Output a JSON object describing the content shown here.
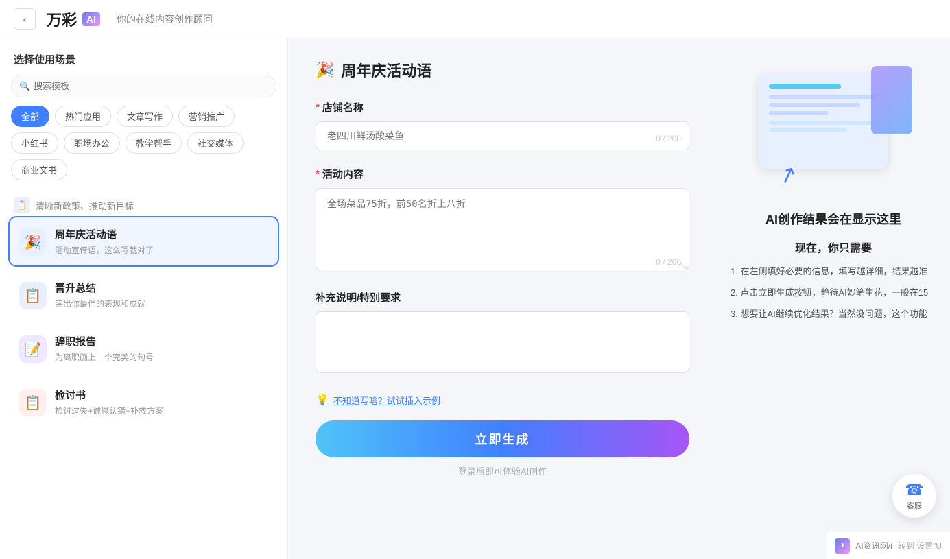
{
  "header": {
    "back_label": "‹",
    "logo_text": "万彩",
    "logo_ai": "AI",
    "subtitle": "你的在线内容创作顾问"
  },
  "sidebar": {
    "title": "选择使用场景",
    "search_placeholder": "搜索模板",
    "tags": [
      {
        "id": "all",
        "label": "全部",
        "active": true
      },
      {
        "id": "hot",
        "label": "热门应用",
        "active": false
      },
      {
        "id": "article",
        "label": "文章写作",
        "active": false
      },
      {
        "id": "marketing",
        "label": "营销推广",
        "active": false
      },
      {
        "id": "xiaohongshu",
        "label": "小红书",
        "active": false
      },
      {
        "id": "office",
        "label": "职场办公",
        "active": false
      },
      {
        "id": "education",
        "label": "教学帮手",
        "active": false
      },
      {
        "id": "social",
        "label": "社交媒体",
        "active": false
      },
      {
        "id": "business",
        "label": "商业文书",
        "active": false
      }
    ],
    "divider_text": "清晰新政策、推动新目标",
    "templates": [
      {
        "id": "anniversary",
        "icon": "🎉",
        "icon_style": "blue",
        "name": "周年庆活动语",
        "desc": "活动宣传语，这么写就对了",
        "active": true
      },
      {
        "id": "promotion",
        "icon": "📋",
        "icon_style": "blue",
        "name": "晋升总结",
        "desc": "突出你最佳的表现和成就",
        "active": false
      },
      {
        "id": "resignation",
        "icon": "📝",
        "icon_style": "purple",
        "name": "辞职报告",
        "desc": "为离职画上一个完美的句号",
        "active": false
      },
      {
        "id": "review",
        "icon": "📋",
        "icon_style": "red",
        "name": "检讨书",
        "desc": "检讨过失+诚恩认错+补救方案",
        "active": false
      }
    ]
  },
  "form": {
    "title": "周年庆活动语",
    "title_icon": "🎉",
    "fields": [
      {
        "id": "shop_name",
        "label": "店铺名称",
        "required": true,
        "type": "input",
        "placeholder": "老四川鲜汤酸菜鱼",
        "char_count": "0 / 200"
      },
      {
        "id": "activity_content",
        "label": "活动内容",
        "required": true,
        "type": "textarea",
        "placeholder": "全场菜品75折，前50名折上八折",
        "char_count": "0 / 200"
      },
      {
        "id": "supplement",
        "label": "补充说明/特别要求",
        "required": false,
        "type": "textarea",
        "placeholder": "",
        "char_count": ""
      }
    ],
    "hint_icon": "💡",
    "hint_text": "不知道写啥？试试插入示例",
    "generate_label": "立即生成",
    "login_hint": "登录后即可体验AI创作"
  },
  "info_panel": {
    "title": "AI创作结果会在显示这里",
    "subtitle": "现在，你只需要",
    "steps": [
      "1. 在左侧填好必要的信息，填写越详细，结果越准",
      "2. 点击立即生成按钮，静待AI妙笔生花，一般在15",
      "3. 想要让AI继续优化结果？当然没问题，这个功能"
    ]
  },
  "customer_service": {
    "icon": "☎",
    "label": "客服"
  },
  "bottom_bar": {
    "text": "AI资讯网/i",
    "suffix": "转到 设置\"U"
  }
}
